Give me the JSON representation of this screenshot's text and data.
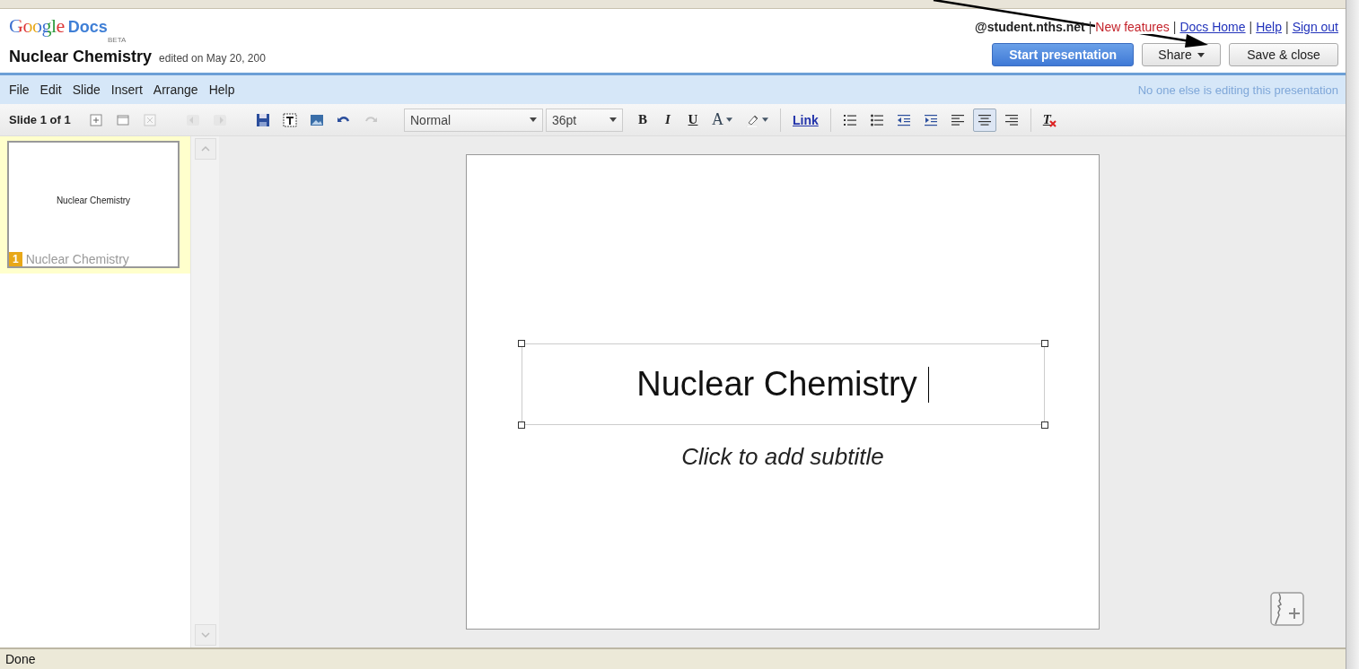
{
  "header": {
    "logo": {
      "brand": "Google",
      "product": "Docs",
      "badge": "BETA"
    },
    "account": "@student.nths.net",
    "links": [
      {
        "divider": "|",
        "label": "New features",
        "kind": "highlight"
      },
      {
        "divider": "|",
        "label": "Docs Home",
        "kind": "link"
      },
      {
        "divider": "|",
        "label": "Help",
        "kind": "link"
      },
      {
        "divider": "|",
        "label": "Sign out",
        "kind": "link"
      }
    ]
  },
  "document": {
    "title": "Nuclear Chemistry",
    "edited": "edited on May 20, 200"
  },
  "actions": [
    {
      "label": "Start presentation",
      "kind": "primary"
    },
    {
      "label": "Share",
      "kind": "menu"
    },
    {
      "label": "Save & close",
      "kind": "plain"
    }
  ],
  "menu": [
    "File",
    "Edit",
    "Slide",
    "Insert",
    "Arrange",
    "Help"
  ],
  "status_message": "No one else is editing this presentation",
  "toolbar": {
    "slide_counter": "Slide 1 of 1",
    "tools": [
      {
        "kind": "new-slide",
        "disabled": false
      },
      {
        "kind": "duplicate-slide",
        "disabled": false
      },
      {
        "kind": "delete-slide",
        "disabled": true
      },
      {
        "kind": "gap"
      },
      {
        "kind": "previous",
        "disabled": true
      },
      {
        "kind": "next",
        "disabled": true
      },
      {
        "kind": "gap"
      },
      {
        "kind": "save",
        "disabled": false
      },
      {
        "kind": "textbox",
        "disabled": false
      },
      {
        "kind": "image",
        "disabled": false
      },
      {
        "kind": "undo",
        "disabled": false
      },
      {
        "kind": "redo",
        "disabled": true
      },
      {
        "kind": "style-select",
        "value": "Normal"
      },
      {
        "kind": "size-select",
        "value": "36pt"
      },
      {
        "kind": "bold",
        "label": "B"
      },
      {
        "kind": "italic",
        "label": "I"
      },
      {
        "kind": "underline",
        "label": "U"
      },
      {
        "kind": "text-color",
        "label": "A"
      },
      {
        "kind": "highlight",
        "disabled": false
      },
      {
        "kind": "separator"
      },
      {
        "kind": "link",
        "label": "Link"
      },
      {
        "kind": "separator"
      },
      {
        "kind": "numbered-list",
        "disabled": false
      },
      {
        "kind": "bulleted-list",
        "disabled": false
      },
      {
        "kind": "outdent",
        "disabled": false
      },
      {
        "kind": "indent",
        "disabled": false
      },
      {
        "kind": "align-left",
        "selected": false
      },
      {
        "kind": "align-center",
        "selected": true
      },
      {
        "kind": "align-right",
        "selected": false
      },
      {
        "kind": "separator"
      },
      {
        "kind": "clear-format",
        "label": "T"
      }
    ]
  },
  "slides": [
    {
      "number": "1",
      "thumb_title": "Nuclear Chemistry",
      "caption": "Nuclear Chemistry",
      "selected": true
    }
  ],
  "slide": {
    "title": "Nuclear Chemistry",
    "title_selected": true,
    "subtitle_placeholder": "Click to add subtitle"
  },
  "status_bar": "Done"
}
